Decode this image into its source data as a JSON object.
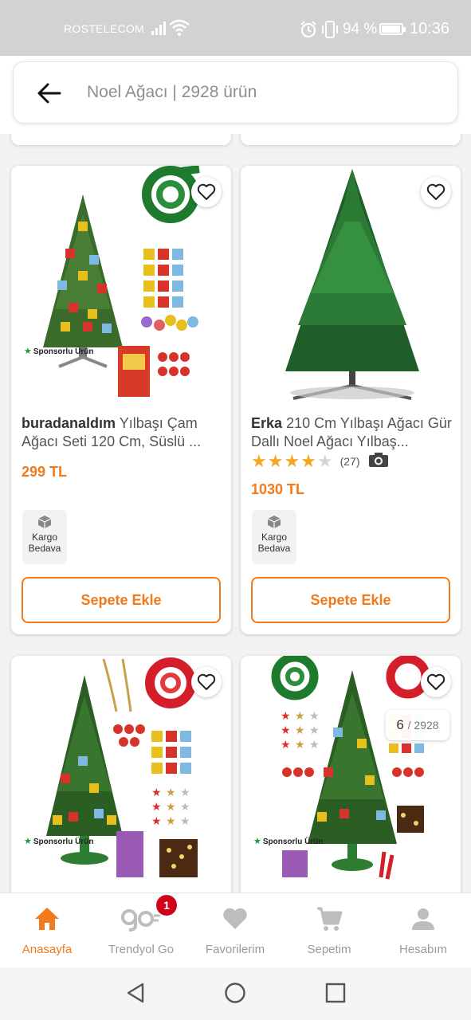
{
  "status_bar": {
    "carrier": "ROSTELECOM",
    "battery": "94 %",
    "time": "10:36"
  },
  "search": {
    "text": "Noel Ağacı | 2928 ürün"
  },
  "products": [
    {
      "brand": "buradanaldım",
      "name": "Yılbaşı Çam Ağacı Seti 120 Cm, Süslü ...",
      "price": "299 TL",
      "sponsored": "Sponsorlu Ürün",
      "shipping_line1": "Kargo",
      "shipping_line2": "Bedava",
      "add_to_cart": "Sepete Ekle"
    },
    {
      "brand": "Erka",
      "name": "210 Cm Yılbaşı Ağacı Gür Dallı Noel Ağacı Yılbaş...",
      "rating_value": 4,
      "rating_count": "(27)",
      "price": "1030 TL",
      "shipping_line1": "Kargo",
      "shipping_line2": "Bedava",
      "add_to_cart": "Sepete Ekle"
    },
    {
      "sponsored": "Sponsorlu Ürün"
    },
    {
      "sponsored": "Sponsorlu Ürün"
    }
  ],
  "page_counter": {
    "current": "6",
    "total": "/ 2928"
  },
  "bottom_nav": [
    {
      "label": "Anasayfa",
      "icon": "home-icon",
      "active": true
    },
    {
      "label": "Trendyol Go",
      "icon": "trendyol-go-icon",
      "badge": "1"
    },
    {
      "label": "Favorilerim",
      "icon": "heart-icon"
    },
    {
      "label": "Sepetim",
      "icon": "cart-icon"
    },
    {
      "label": "Hesabım",
      "icon": "user-icon"
    }
  ],
  "colors": {
    "accent": "#f27a1a",
    "badge": "#d0021b",
    "star": "#f5a623"
  }
}
